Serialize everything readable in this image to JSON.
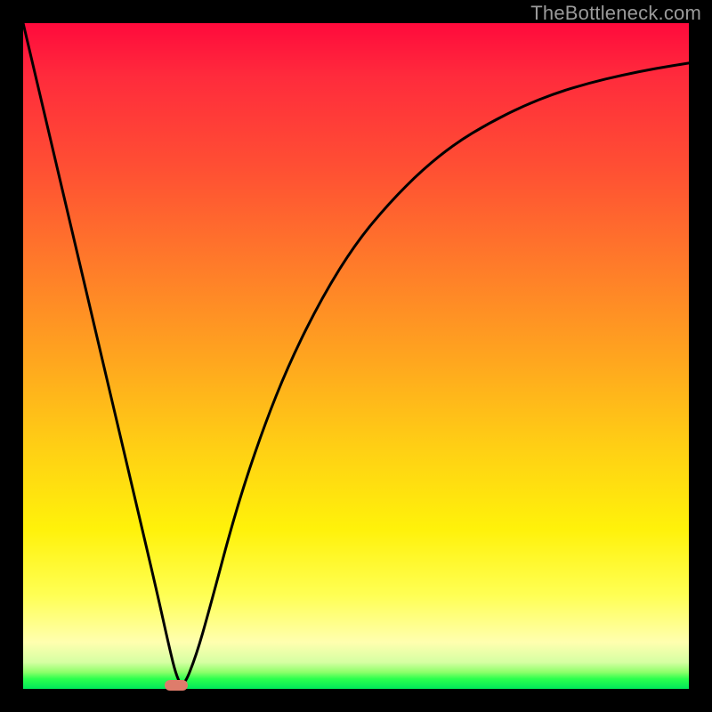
{
  "watermark": "TheBottleneck.com",
  "chart_data": {
    "type": "line",
    "title": "",
    "xlabel": "",
    "ylabel": "",
    "xlim": [
      0,
      100
    ],
    "ylim": [
      0,
      100
    ],
    "grid": false,
    "legend": false,
    "series": [
      {
        "name": "bottleneck-curve",
        "color": "#000000",
        "x": [
          0,
          4,
          8,
          12,
          16,
          20,
          22,
          23,
          24,
          26,
          28,
          32,
          36,
          40,
          45,
          50,
          55,
          60,
          65,
          70,
          75,
          80,
          85,
          90,
          95,
          100
        ],
        "y": [
          100,
          83,
          66,
          49,
          32,
          15,
          6,
          2,
          0,
          5,
          12,
          27,
          39,
          49,
          59,
          67,
          73,
          78,
          82,
          85,
          87.5,
          89.5,
          91,
          92.2,
          93.2,
          94
        ]
      }
    ],
    "marker": {
      "name": "optimal-point",
      "x": 23,
      "y": 0.5,
      "color": "#de7c6b"
    },
    "gradient_stops": [
      {
        "pos": 0,
        "color": "#ff0a3c"
      },
      {
        "pos": 0.08,
        "color": "#ff2b3c"
      },
      {
        "pos": 0.22,
        "color": "#ff5033"
      },
      {
        "pos": 0.36,
        "color": "#ff7a2a"
      },
      {
        "pos": 0.5,
        "color": "#ffa41f"
      },
      {
        "pos": 0.64,
        "color": "#ffd014"
      },
      {
        "pos": 0.76,
        "color": "#fff20a"
      },
      {
        "pos": 0.86,
        "color": "#ffff55"
      },
      {
        "pos": 0.93,
        "color": "#ffffaf"
      },
      {
        "pos": 0.96,
        "color": "#d6ffa3"
      },
      {
        "pos": 0.975,
        "color": "#8dff6a"
      },
      {
        "pos": 0.985,
        "color": "#2cff4e"
      },
      {
        "pos": 1.0,
        "color": "#00e85a"
      }
    ]
  }
}
